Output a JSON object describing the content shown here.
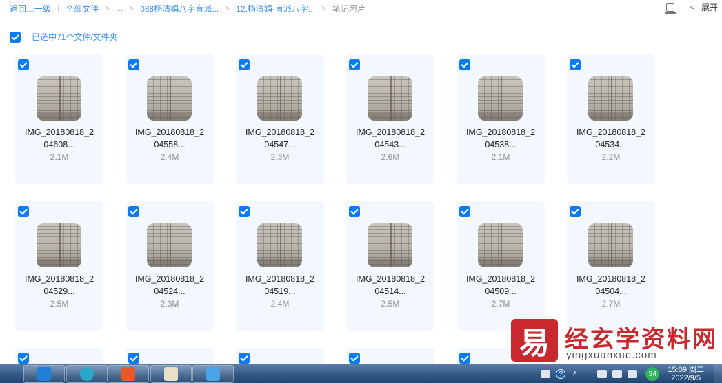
{
  "breadcrumb": {
    "back": "返回上一级",
    "root": "全部文件",
    "ellipsis": "...",
    "folder1": "088杨清娟八字盲派...",
    "folder2": "12.杨清娟-盲派八字...",
    "current": "笔记照片"
  },
  "top_right": {
    "expand_label": "展开"
  },
  "selection": {
    "label": "已选中71个文件/文件夹"
  },
  "files": [
    {
      "name1": "IMG_20180818_2",
      "name2": "04608...",
      "size": "2.1M"
    },
    {
      "name1": "IMG_20180818_2",
      "name2": "04558...",
      "size": "2.4M"
    },
    {
      "name1": "IMG_20180818_2",
      "name2": "04547...",
      "size": "2.3M"
    },
    {
      "name1": "IMG_20180818_2",
      "name2": "04543...",
      "size": "2.6M"
    },
    {
      "name1": "IMG_20180818_2",
      "name2": "04538...",
      "size": "2.1M"
    },
    {
      "name1": "IMG_20180818_2",
      "name2": "04534...",
      "size": "2.2M"
    },
    {
      "name1": "IMG_20180818_2",
      "name2": "04529...",
      "size": "2.5M"
    },
    {
      "name1": "IMG_20180818_2",
      "name2": "04524...",
      "size": "2.3M"
    },
    {
      "name1": "IMG_20180818_2",
      "name2": "04519...",
      "size": "2.4M"
    },
    {
      "name1": "IMG_20180818_2",
      "name2": "04514...",
      "size": "2.5M"
    },
    {
      "name1": "IMG_20180818_2",
      "name2": "04509...",
      "size": "2.7M"
    },
    {
      "name1": "IMG_20180818_2",
      "name2": "04504...",
      "size": "2.7M"
    }
  ],
  "watermark": {
    "logo_char": "易",
    "name": "经玄学资料网",
    "url": "yingxuanxue.com"
  },
  "taskbar": {
    "clock_time": "15:09 周二",
    "clock_date": "2022/9/5",
    "badge": "34",
    "help": "?",
    "apps": [
      "vscode-icon",
      "app-p-icon",
      "app-orange-icon",
      "notepad-icon",
      "folder-icon"
    ]
  },
  "colors": {
    "accent": "#0a7bf0",
    "link": "#3b8ef0",
    "card_bg": "#f2f8fd",
    "brand_red": "#c8282e"
  }
}
